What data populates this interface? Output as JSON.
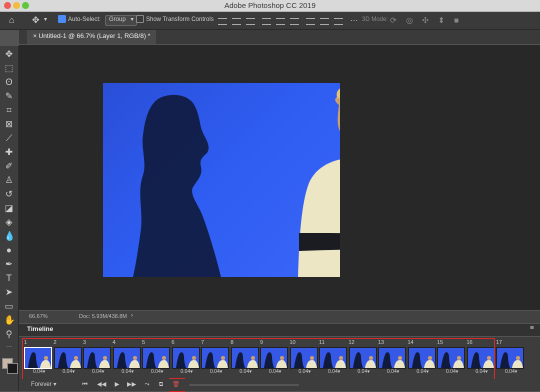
{
  "app": {
    "window_title": "Adobe Photoshop CC 2019"
  },
  "options_bar": {
    "auto_select_label": "Auto-Select:",
    "auto_select_checked": true,
    "auto_select_mode": "Group",
    "show_transform_label": "Show Transform Controls",
    "show_transform_checked": false,
    "mode_3d_label": "3D Mode:"
  },
  "document": {
    "tab_title": "Untitled-1 @ 66.7% (Layer 1, RGB/8) *"
  },
  "status": {
    "zoom": "66.67%",
    "doc_size": "Doc: 5.93M/438.8M"
  },
  "timeline": {
    "label": "Timeline",
    "loop_option": "Forever",
    "frames": [
      {
        "num": "1",
        "dur": "0.04"
      },
      {
        "num": "2",
        "dur": "0.04"
      },
      {
        "num": "3",
        "dur": "0.04"
      },
      {
        "num": "4",
        "dur": "0.04"
      },
      {
        "num": "5",
        "dur": "0.04"
      },
      {
        "num": "6",
        "dur": "0.04"
      },
      {
        "num": "7",
        "dur": "0.04"
      },
      {
        "num": "8",
        "dur": "0.04"
      },
      {
        "num": "9",
        "dur": "0.04"
      },
      {
        "num": "10",
        "dur": "0.04"
      },
      {
        "num": "11",
        "dur": "0.04"
      },
      {
        "num": "12",
        "dur": "0.04"
      },
      {
        "num": "13",
        "dur": "0.04"
      },
      {
        "num": "14",
        "dur": "0.04"
      },
      {
        "num": "15",
        "dur": "0.04"
      },
      {
        "num": "16",
        "dur": "0.04"
      },
      {
        "num": "17",
        "dur": "0.04"
      }
    ]
  },
  "colors": {
    "highlight": "#d62a2a",
    "canvas_blue": "#2f5df2",
    "foreground_swatch": "#c8b8a8",
    "background_swatch": "#1a1a1a"
  }
}
